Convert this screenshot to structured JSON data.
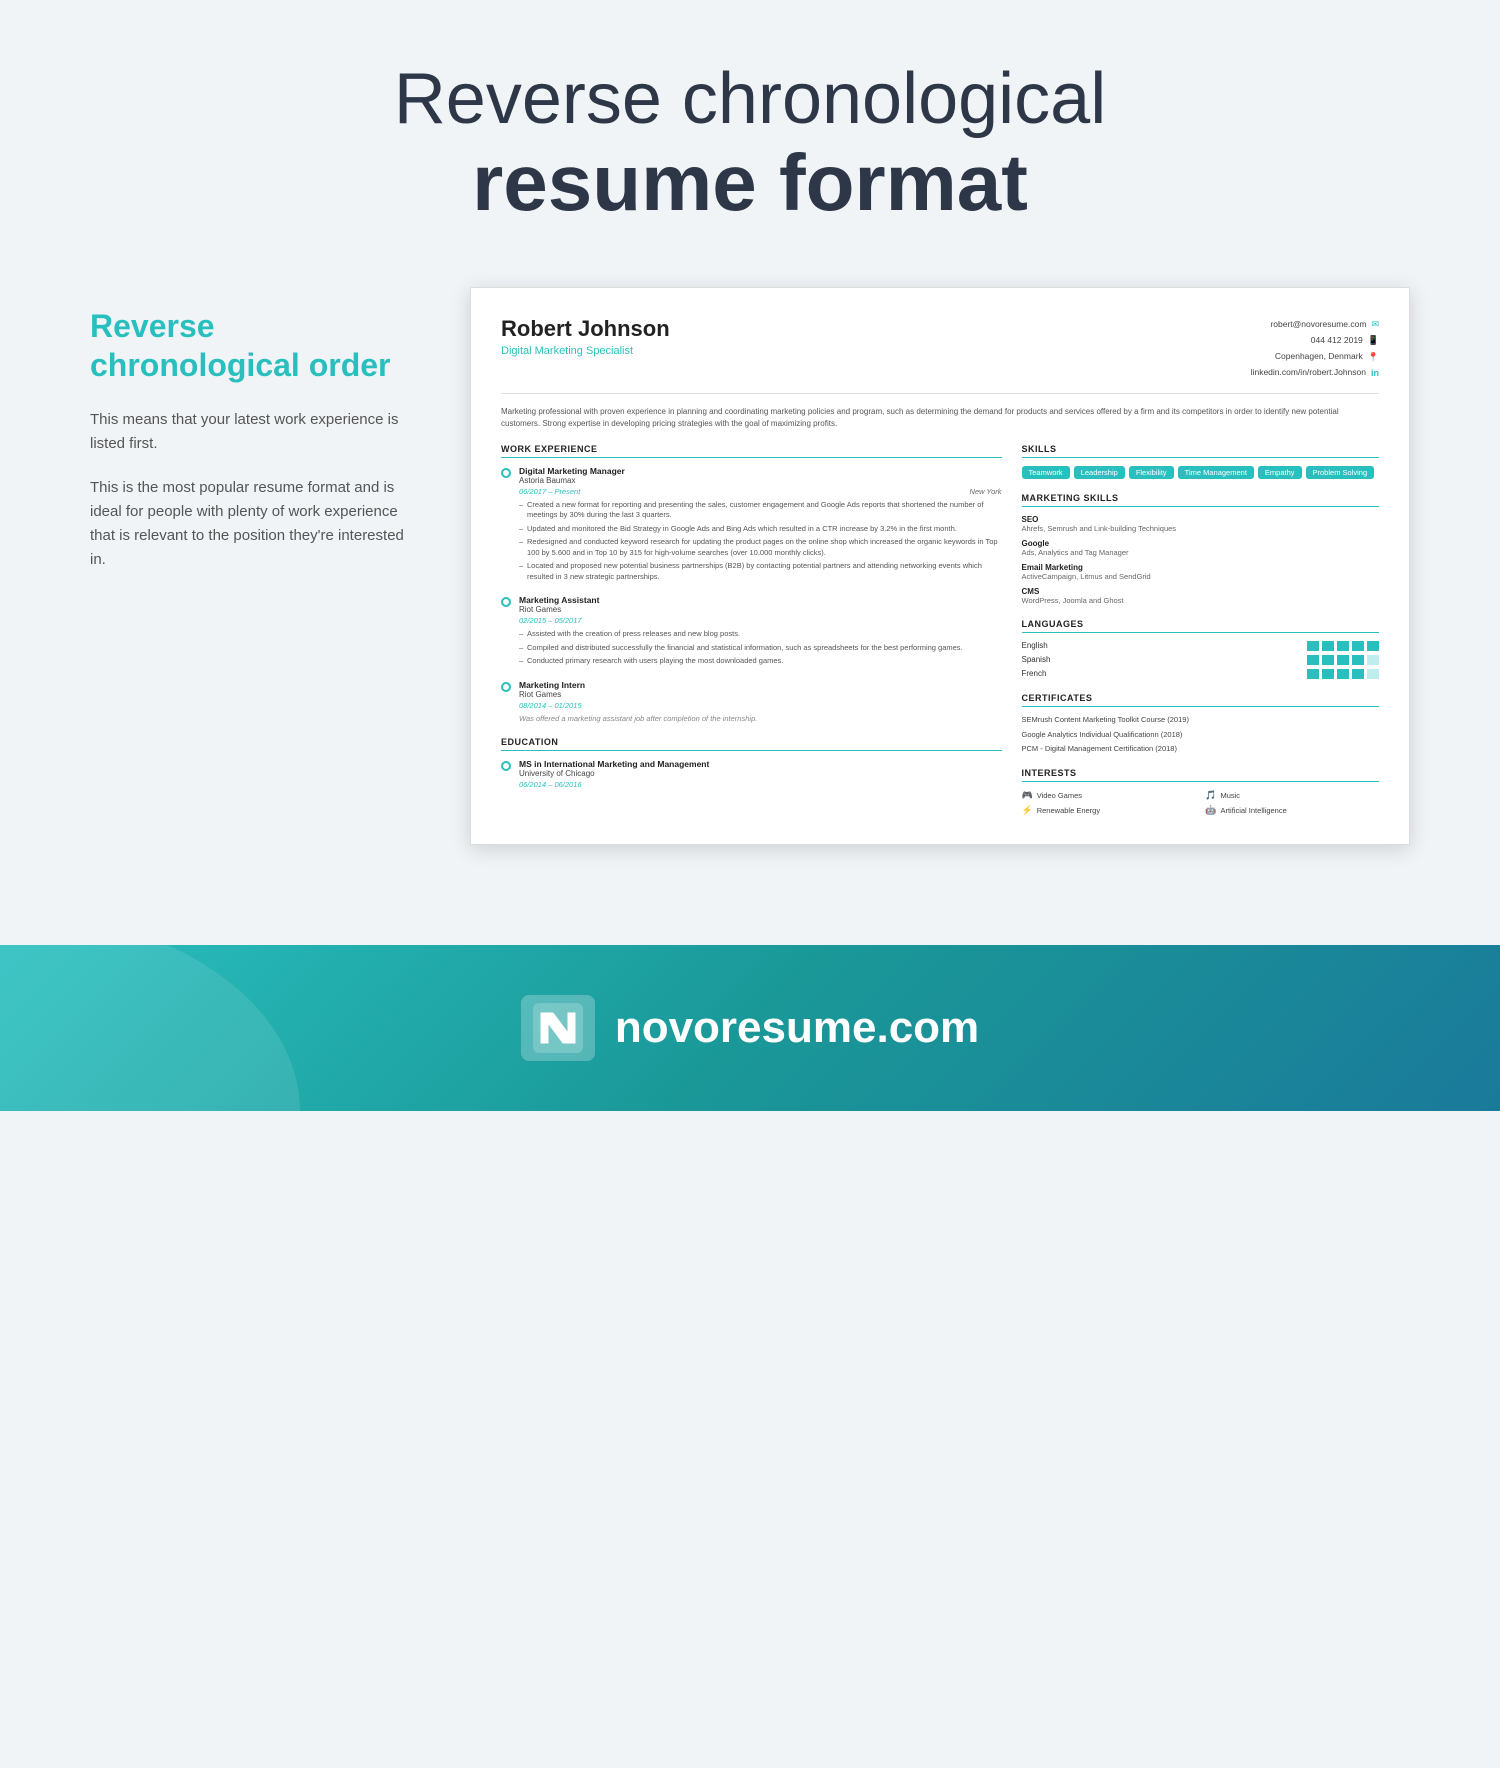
{
  "header": {
    "title_light": "Reverse chronological",
    "title_bold": "resume format"
  },
  "left_panel": {
    "title": "Reverse chronological order",
    "description1": "This means that your latest work experience is listed first.",
    "description2": "This is the most popular resume format and is ideal for people with plenty of work experience that is relevant to the position they're interested in."
  },
  "resume": {
    "name": "Robert Johnson",
    "title": "Digital Marketing Specialist",
    "contact": {
      "email": "robert@novoresume.com",
      "phone": "044 412 2019",
      "location": "Copenhagen, Denmark",
      "linkedin": "linkedin.com/in/robert.Johnson"
    },
    "summary": "Marketing professional with proven experience in planning and coordinating marketing policies and program, such as determining the demand for products and services offered by a firm and its competitors in order to identify new potential customers. Strong expertise in developing pricing strategies with the goal of maximizing profits.",
    "work_experience_title": "WORK EXPERIENCE",
    "work_experience": [
      {
        "job_title": "Digital Marketing Manager",
        "company": "Astoria Baumax",
        "date": "06/2017 – Present",
        "location": "New York",
        "bullets": [
          "Created a new format for reporting and presenting the sales, customer engagement and Google Ads reports that shortened the number of meetings by 30% during the last 3 quarters.",
          "Updated and monitored the Bid Strategy in Google Ads and Bing Ads which resulted in a CTR increase by 3.2% in the first month.",
          "Redesigned and conducted keyword research for updating the product pages on the online shop which increased the organic keywords in Top 100 by 5.600 and in Top 10 by 315 for high-volume searches (over 10.000 monthly clicks).",
          "Located and proposed new potential business partnerships (B2B) by contacting potential partners and attending networking events which resulted in 3 new strategic partnerships."
        ],
        "note": ""
      },
      {
        "job_title": "Marketing Assistant",
        "company": "Riot Games",
        "date": "02/2015 – 05/2017",
        "location": "",
        "bullets": [
          "Assisted with the creation of press releases and new blog posts.",
          "Compiled and distributed successfully the financial and statistical information, such as spreadsheets for the best performing games.",
          "Conducted primary research with users playing the most downloaded games."
        ],
        "note": ""
      },
      {
        "job_title": "Marketing Intern",
        "company": "Riot Games",
        "date": "08/2014 – 01/2015",
        "location": "",
        "bullets": [],
        "note": "Was offered a marketing assistant job after completion of the internship."
      }
    ],
    "education_title": "EDUCATION",
    "education": [
      {
        "degree": "MS in International Marketing and Management",
        "school": "University of Chicago",
        "date": "06/2014 – 06/2016"
      }
    ],
    "skills_title": "SKILLS",
    "skills": [
      "Teamwork",
      "Leadership",
      "Flexibility",
      "Time Management",
      "Empathy",
      "Problem Solving"
    ],
    "marketing_skills_title": "MARKETING SKILLS",
    "marketing_skills": [
      {
        "name": "SEO",
        "detail": "Ahrefs, Semrush and Link-building Techniques"
      },
      {
        "name": "Google",
        "detail": "Ads, Analytics and Tag Manager"
      },
      {
        "name": "Email Marketing",
        "detail": "ActiveCampaign, Litmus and SendGrid"
      },
      {
        "name": "CMS",
        "detail": "WordPress, Joomla and Ghost"
      }
    ],
    "languages_title": "LANGUAGES",
    "languages": [
      {
        "name": "English",
        "level": 5
      },
      {
        "name": "Spanish",
        "level": 4
      },
      {
        "name": "French",
        "level": 4
      }
    ],
    "certificates_title": "CERTIFICATES",
    "certificates": [
      "SEMrush Content Marketing Toolkit Course (2019)",
      "Google Analytics Individual Qualificationn (2018)",
      "PCM - Digital Management Certification (2018)"
    ],
    "interests_title": "INTERESTS",
    "interests": [
      {
        "icon": "🎮",
        "label": "Video Games"
      },
      {
        "icon": "🎵",
        "label": "Music"
      },
      {
        "icon": "⚡",
        "label": "Renewable Energy"
      },
      {
        "icon": "🤖",
        "label": "Artificial Intelligence"
      }
    ]
  },
  "footer": {
    "brand_name": "novoresume.com"
  },
  "colors": {
    "teal": "#2abfbf",
    "dark": "#2d3748"
  }
}
